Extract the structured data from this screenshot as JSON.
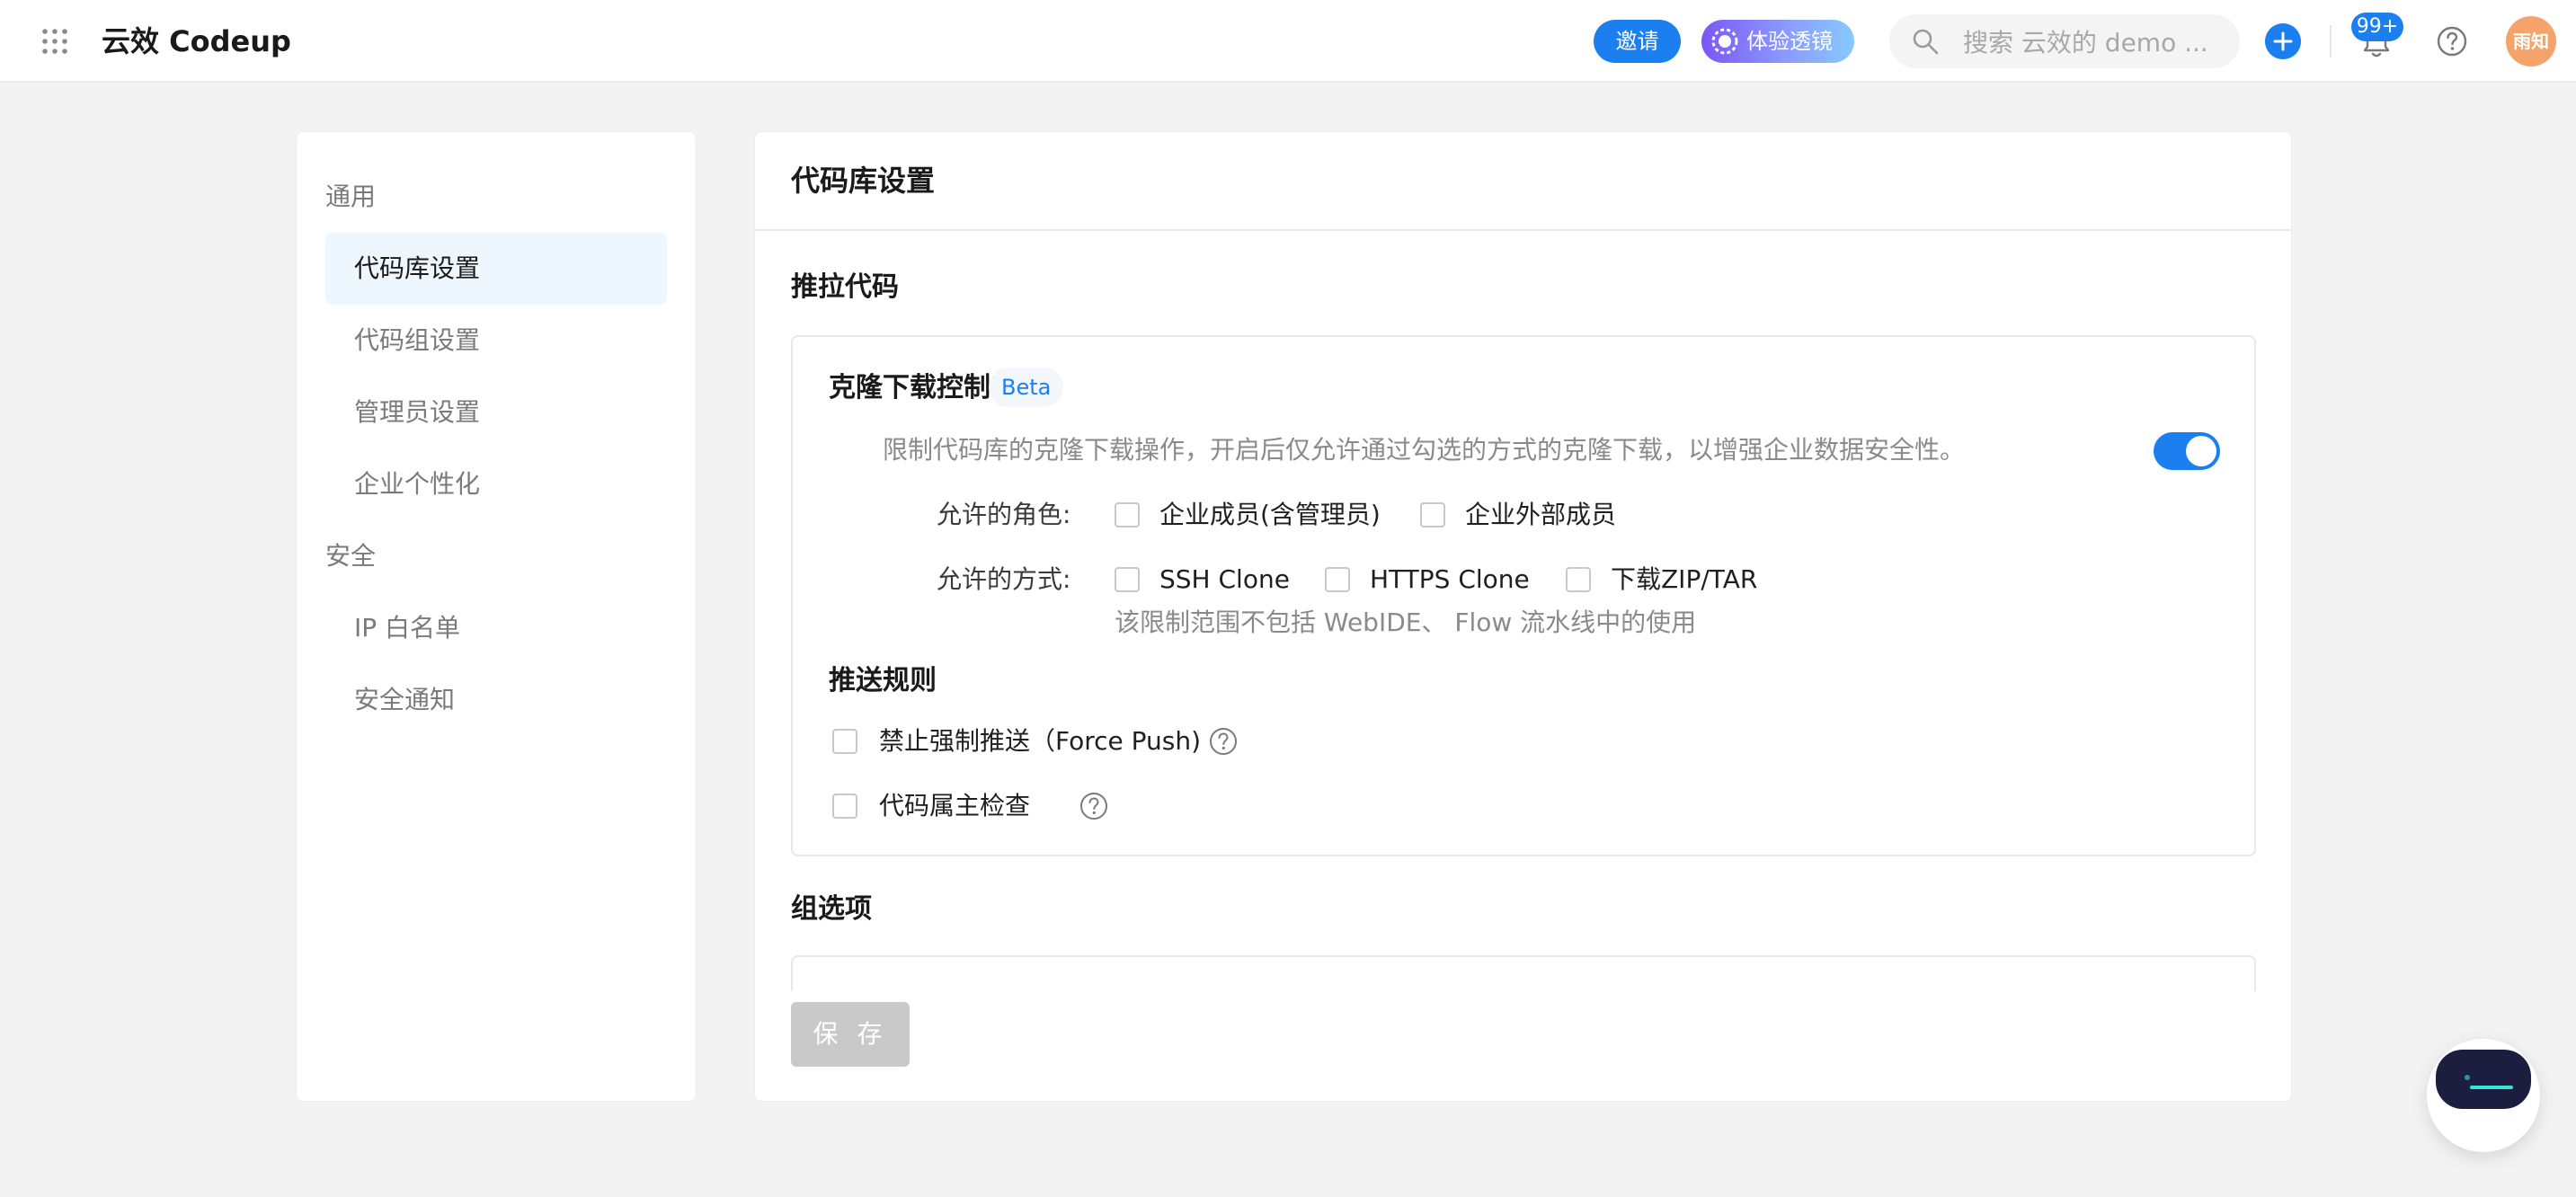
{
  "header": {
    "app_title": "云效 Codeup",
    "invite_label": "邀请",
    "lens_label": "体验透镜",
    "search_placeholder": "搜索 云效的 demo ...",
    "notification_count": "99+",
    "avatar_text": "雨知",
    "icons": [
      "apps-grid-icon",
      "lens-icon",
      "search-icon",
      "plus-icon",
      "bell-icon",
      "help-icon"
    ]
  },
  "sidebar": {
    "groups": [
      {
        "label": "通用",
        "items": [
          {
            "label": "代码库设置",
            "active": true
          },
          {
            "label": "代码组设置"
          },
          {
            "label": "管理员设置"
          },
          {
            "label": "企业个性化"
          }
        ]
      },
      {
        "label": "安全",
        "items": [
          {
            "label": "IP 白名单"
          },
          {
            "label": "安全通知"
          }
        ]
      }
    ]
  },
  "main": {
    "title": "代码库设置",
    "section_push_pull": "推拉代码",
    "clone_control": {
      "title": "克隆下载控制",
      "beta": "Beta",
      "description": "限制代码库的克隆下载操作，开启后仅允许通过勾选的方式的克隆下载，以增强企业数据安全性。",
      "enabled": true,
      "roles_label": "允许的角色:",
      "roles": [
        "企业成员(含管理员)",
        "企业外部成员"
      ],
      "methods_label": "允许的方式:",
      "methods": [
        "SSH Clone",
        "HTTPS Clone",
        "下载ZIP/TAR"
      ],
      "note": "该限制范围不包括 WebIDE、 Flow 流水线中的使用"
    },
    "push_rules": {
      "title": "推送规则",
      "force_push": "禁止强制推送（Force Push)",
      "owner_check": "代码属主检查"
    },
    "section_group_options": "组选项",
    "save_label": "保 存"
  },
  "colors": {
    "accent": "#1b7ff0",
    "avatar": "#f4a36b",
    "disabled": "#c9c9c9"
  }
}
